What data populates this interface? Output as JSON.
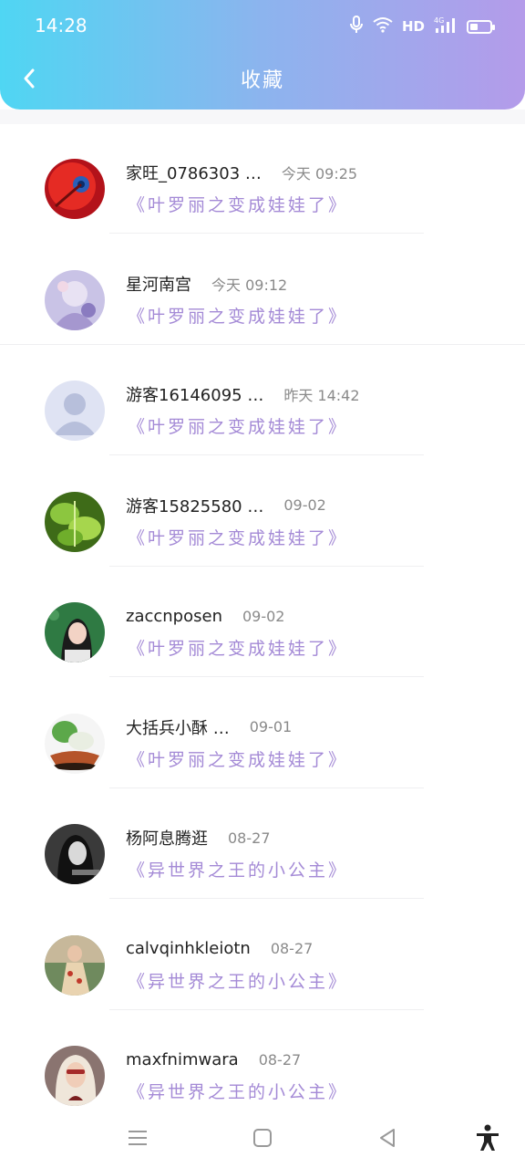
{
  "status_bar": {
    "time": "14:28",
    "network": "HD",
    "cell_label": "4G",
    "icons": [
      "microphone-icon",
      "wifi-icon",
      "signal-icon",
      "battery-icon"
    ]
  },
  "nav": {
    "title": "收藏",
    "back_icon": "chevron-left-icon"
  },
  "colors": {
    "header_gradient_start": "#4fd6f3",
    "header_gradient_end": "#b49bea",
    "book_title": "#a48ad6",
    "nickname": "#222222",
    "time": "#8a8a8a"
  },
  "items": [
    {
      "nickname": "家旺_0786303 …",
      "time": "今天 09:25",
      "book": "《叶罗丽之变成娃娃了》",
      "avatar": "red-fruit-avatar"
    },
    {
      "nickname": "星河南宫",
      "time": "今天 09:12",
      "book": "《叶罗丽之变成娃娃了》",
      "avatar": "anime-girl-avatar"
    },
    {
      "nickname": "游客16146095 …",
      "time": "昨天 14:42",
      "book": "《叶罗丽之变成娃娃了》",
      "avatar": "default-user-avatar"
    },
    {
      "nickname": "游客15825580 …",
      "time": "09-02",
      "book": "《叶罗丽之变成娃娃了》",
      "avatar": "green-leaves-avatar"
    },
    {
      "nickname": "zaccnposen",
      "time": "09-02",
      "book": "《叶罗丽之变成娃娃了》",
      "avatar": "woman-portrait-avatar"
    },
    {
      "nickname": "大括兵小酥 …",
      "time": "09-01",
      "book": "《叶罗丽之变成娃娃了》",
      "avatar": "jade-cabbage-avatar"
    },
    {
      "nickname": "杨阿息腾逛",
      "time": "08-27",
      "book": "《异世界之王的小公主》",
      "avatar": "monochrome-portrait-avatar"
    },
    {
      "nickname": "calvqinhkleiotn",
      "time": "08-27",
      "book": "《异世界之王的小公主》",
      "avatar": "girl-in-dress-avatar"
    },
    {
      "nickname": "maxfnimwara",
      "time": "08-27",
      "book": "《异世界之王的小公主》",
      "avatar": "blonde-woman-avatar"
    }
  ],
  "bottom_nav": {
    "icons": [
      "menu-icon",
      "home-square-icon",
      "back-triangle-icon",
      "accessibility-icon"
    ]
  }
}
